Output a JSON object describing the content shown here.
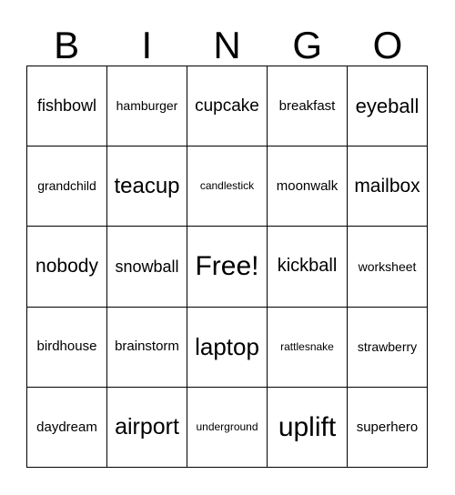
{
  "card": {
    "type": "bingo-card",
    "columns": 5,
    "rows": 5,
    "background_color": "#ffffff",
    "border_color": "#000000",
    "text_color": "#000000",
    "header": {
      "letters": [
        "B",
        "I",
        "N",
        "G",
        "O"
      ]
    },
    "free_space": {
      "label": "Free!",
      "row": 3,
      "column": 3
    },
    "rows_data": [
      {
        "cells": [
          {
            "label": "fishbowl",
            "font_size": 18
          },
          {
            "label": "hamburger",
            "font_size": 14
          },
          {
            "label": "cupcake",
            "font_size": 19
          },
          {
            "label": "breakfast",
            "font_size": 15
          },
          {
            "label": "eyeball",
            "font_size": 22
          }
        ]
      },
      {
        "cells": [
          {
            "label": "grandchild",
            "font_size": 14
          },
          {
            "label": "teacup",
            "font_size": 24
          },
          {
            "label": "candlestick",
            "font_size": 12
          },
          {
            "label": "moonwalk",
            "font_size": 15
          },
          {
            "label": "mailbox",
            "font_size": 21
          }
        ]
      },
      {
        "cells": [
          {
            "label": "nobody",
            "font_size": 21
          },
          {
            "label": "snowball",
            "font_size": 18
          },
          {
            "label": "Free!",
            "font_size": 30
          },
          {
            "label": "kickball",
            "font_size": 20
          },
          {
            "label": "worksheet",
            "font_size": 14
          }
        ]
      },
      {
        "cells": [
          {
            "label": "birdhouse",
            "font_size": 15
          },
          {
            "label": "brainstorm",
            "font_size": 15
          },
          {
            "label": "laptop",
            "font_size": 26
          },
          {
            "label": "rattlesnake",
            "font_size": 12
          },
          {
            "label": "strawberry",
            "font_size": 14
          }
        ]
      },
      {
        "cells": [
          {
            "label": "daydream",
            "font_size": 15
          },
          {
            "label": "airport",
            "font_size": 25
          },
          {
            "label": "underground",
            "font_size": 12
          },
          {
            "label": "uplift",
            "font_size": 30
          },
          {
            "label": "superhero",
            "font_size": 15
          }
        ]
      }
    ]
  }
}
